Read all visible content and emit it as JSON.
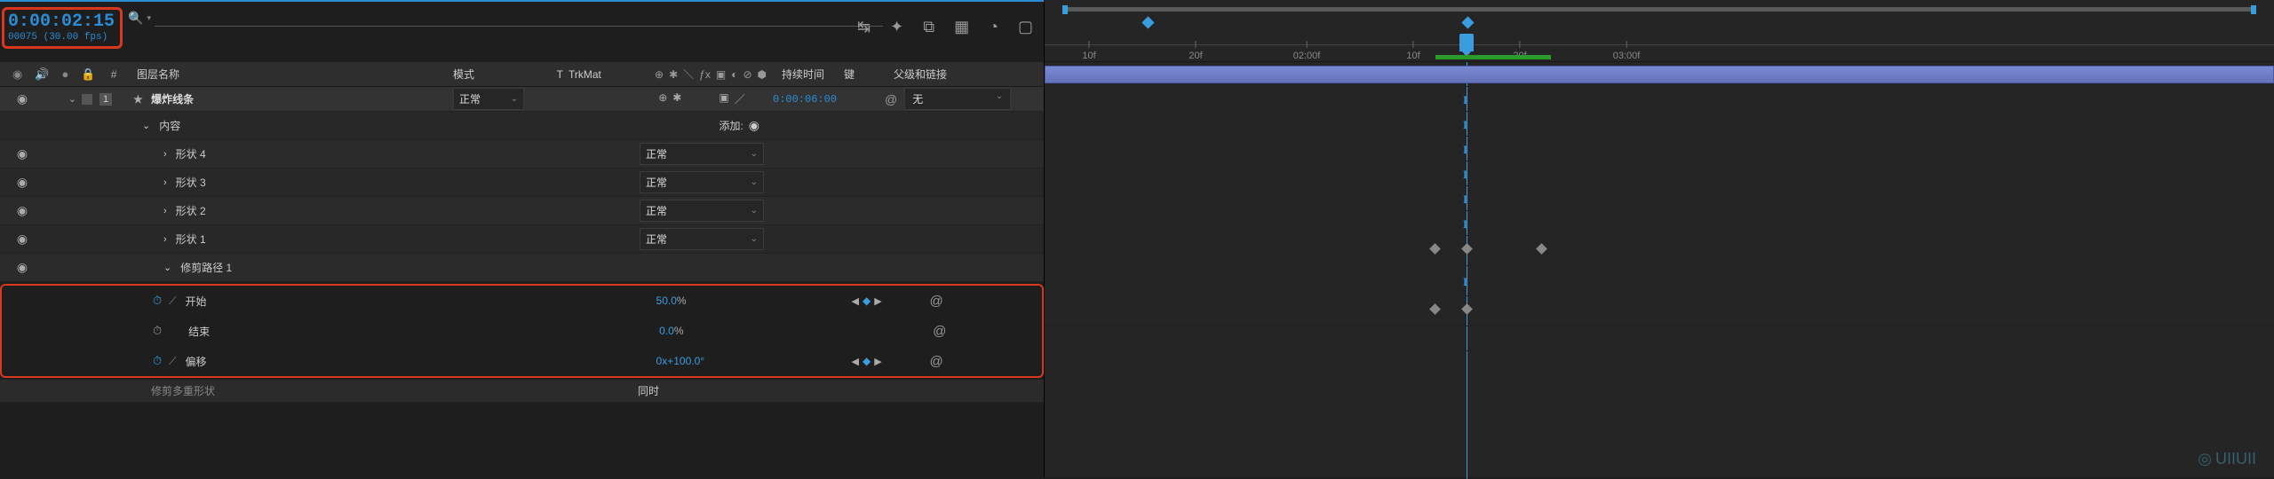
{
  "timecode": {
    "main": "0:00:02:15",
    "sub": "00075 (30.00 fps)"
  },
  "columns": {
    "index": "#",
    "layerName": "图层名称",
    "mode": "模式",
    "t": "T",
    "trkmat": "TrkMat",
    "duration": "持续时间",
    "keys": "键",
    "parent": "父级和链接"
  },
  "layer": {
    "index": "1",
    "name": "爆炸线条",
    "mode": "正常",
    "duration": "0:00:06:00",
    "parent": "无"
  },
  "contents": {
    "label": "内容",
    "add": "添加:"
  },
  "shapes": [
    {
      "name": "形状 4",
      "mode": "正常"
    },
    {
      "name": "形状 3",
      "mode": "正常"
    },
    {
      "name": "形状 2",
      "mode": "正常"
    },
    {
      "name": "形状 1",
      "mode": "正常"
    }
  ],
  "trimPaths": {
    "groupName": "修剪路径 1",
    "start": {
      "label": "开始",
      "value": "50.0",
      "pct": "%"
    },
    "end": {
      "label": "结束",
      "value": "0.0",
      "pct": "%"
    },
    "offset": {
      "label": "偏移",
      "value": "0x+100.0°"
    },
    "multi": {
      "label": "修剪多重形状",
      "value": "同时"
    }
  },
  "ruler": [
    "10f",
    "20f",
    "02:00f",
    "10f",
    "20f",
    "03:00f"
  ],
  "watermark": "UIIUII"
}
